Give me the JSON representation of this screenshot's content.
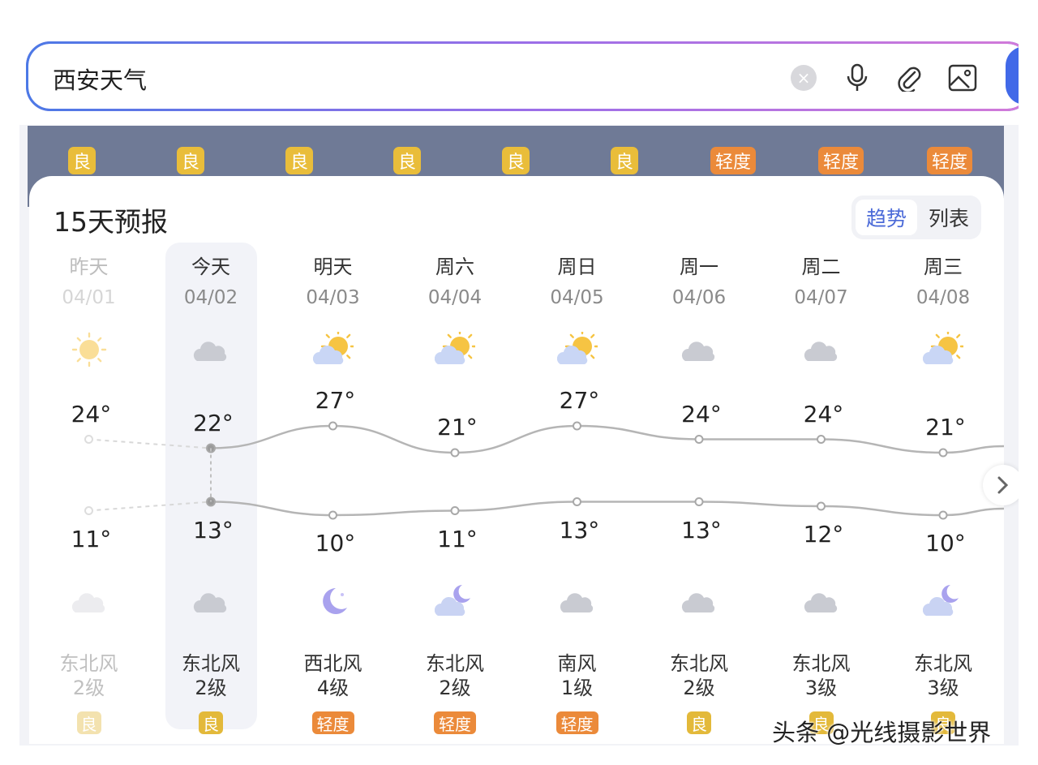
{
  "search": {
    "query": "西安天气"
  },
  "aqi_strip": [
    {
      "label": "良",
      "level": "good"
    },
    {
      "label": "良",
      "level": "good"
    },
    {
      "label": "良",
      "level": "good"
    },
    {
      "label": "良",
      "level": "good"
    },
    {
      "label": "良",
      "level": "good"
    },
    {
      "label": "良",
      "level": "good"
    },
    {
      "label": "轻度",
      "level": "light"
    },
    {
      "label": "轻度",
      "level": "light"
    },
    {
      "label": "轻度",
      "level": "light"
    }
  ],
  "forecast": {
    "title": "15天预报",
    "view_toggle": {
      "trend": "趋势",
      "list": "列表",
      "active": "trend"
    },
    "days": [
      {
        "day": "昨天",
        "date": "04/01",
        "high": "24°",
        "low": "11°",
        "wind": "东北风",
        "wind_level": "2级",
        "aqi": "良",
        "aqi_level": "good",
        "day_icon": "sun-icon",
        "night_icon": "cloud-icon",
        "faded": true
      },
      {
        "day": "今天",
        "date": "04/02",
        "high": "22°",
        "low": "13°",
        "wind": "东北风",
        "wind_level": "2级",
        "aqi": "良",
        "aqi_level": "good",
        "day_icon": "cloud-icon",
        "night_icon": "cloud-icon"
      },
      {
        "day": "明天",
        "date": "04/03",
        "high": "27°",
        "low": "10°",
        "wind": "西北风",
        "wind_level": "4级",
        "aqi": "轻度",
        "aqi_level": "light",
        "day_icon": "partly-sunny-icon",
        "night_icon": "moon-icon"
      },
      {
        "day": "周六",
        "date": "04/04",
        "high": "21°",
        "low": "11°",
        "wind": "东北风",
        "wind_level": "2级",
        "aqi": "轻度",
        "aqi_level": "light",
        "day_icon": "partly-sunny-icon",
        "night_icon": "moon-cloud-icon"
      },
      {
        "day": "周日",
        "date": "04/05",
        "high": "27°",
        "low": "13°",
        "wind": "南风",
        "wind_level": "1级",
        "aqi": "轻度",
        "aqi_level": "light",
        "day_icon": "partly-sunny-icon",
        "night_icon": "cloud-icon"
      },
      {
        "day": "周一",
        "date": "04/06",
        "high": "24°",
        "low": "13°",
        "wind": "东北风",
        "wind_level": "2级",
        "aqi": "良",
        "aqi_level": "good",
        "day_icon": "cloud-icon",
        "night_icon": "cloud-icon"
      },
      {
        "day": "周二",
        "date": "04/07",
        "high": "24°",
        "low": "12°",
        "wind": "东北风",
        "wind_level": "3级",
        "aqi": "良",
        "aqi_level": "good",
        "day_icon": "cloud-icon",
        "night_icon": "cloud-icon"
      },
      {
        "day": "周三",
        "date": "04/08",
        "high": "21°",
        "low": "10°",
        "wind": "东北风",
        "wind_level": "3级",
        "aqi": "良",
        "aqi_level": "good",
        "day_icon": "partly-sunny-icon",
        "night_icon": "moon-cloud-icon"
      }
    ]
  },
  "chart_data": {
    "type": "line",
    "categories": [
      "04/01",
      "04/02",
      "04/03",
      "04/04",
      "04/05",
      "04/06",
      "04/07",
      "04/08"
    ],
    "series": [
      {
        "values": [
          24,
          22,
          27,
          21,
          27,
          24,
          24,
          21
        ]
      },
      {
        "values": [
          11,
          13,
          10,
          11,
          13,
          13,
          12,
          10
        ]
      }
    ]
  },
  "watermark": "头条 @光线摄影世界",
  "colors": {
    "accent": "#4b6ad8",
    "good": "#e9bd3a",
    "light": "#eb8a3a",
    "strip": "#6f7a96"
  }
}
